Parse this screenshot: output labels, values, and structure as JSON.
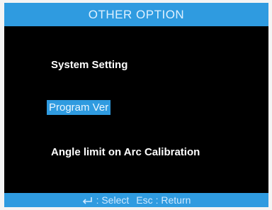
{
  "title": "OTHER OPTION",
  "menu": {
    "items": [
      {
        "label": "System Setting",
        "selected": false
      },
      {
        "label": "Program Ver",
        "selected": true
      },
      {
        "label": "Angle limit on Arc Calibration",
        "selected": false
      }
    ]
  },
  "footer": {
    "select_key_icon": "enter-icon",
    "select_label": ": Select",
    "return_key": "Esc",
    "return_label": ": Return"
  },
  "colors": {
    "screen_bg": "#000000",
    "accent_bar": "#2f9be0",
    "text": "#ffffff"
  }
}
